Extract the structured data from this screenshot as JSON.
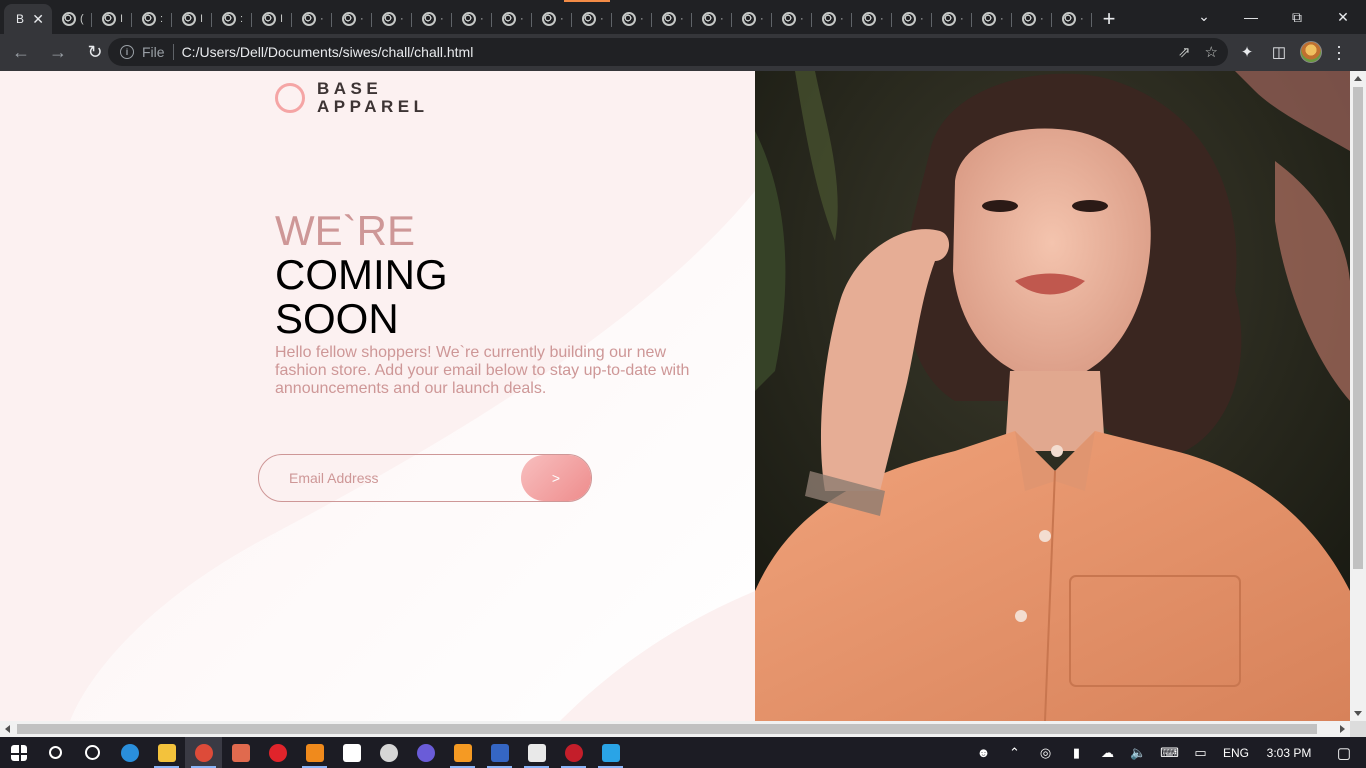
{
  "browser": {
    "active_tab": {
      "title": "B",
      "close": "✕"
    },
    "tabs": [
      {
        "title": "("
      },
      {
        "title": "I"
      },
      {
        "title": ":"
      },
      {
        "title": "I"
      },
      {
        "title": ":"
      },
      {
        "title": "I"
      },
      {
        "title": "·"
      },
      {
        "title": "·"
      },
      {
        "title": "·"
      },
      {
        "title": "·"
      },
      {
        "title": "·"
      },
      {
        "title": "·"
      },
      {
        "title": "·"
      },
      {
        "title": "·"
      },
      {
        "title": "·"
      },
      {
        "title": "·"
      },
      {
        "title": "·"
      },
      {
        "title": "·"
      },
      {
        "title": "·"
      },
      {
        "title": "·"
      },
      {
        "title": "·"
      },
      {
        "title": "·"
      },
      {
        "title": "·"
      },
      {
        "title": "·"
      },
      {
        "title": "·"
      },
      {
        "title": "·"
      }
    ],
    "new_tab_label": "+",
    "url_scheme": "File",
    "url": "C:/Users/Dell/Documents/siwes/chall/chall.html"
  },
  "page": {
    "logo": {
      "line1": "BASE",
      "line2": "APPAREL"
    },
    "headline": {
      "line1": "WE`RE",
      "line2": "COMING",
      "line3": "SOON"
    },
    "intro": "Hello fellow shoppers! We`re currently building our new fashion store. Add your email below to stay up-to-date with announcements and our launch deals.",
    "email_placeholder": "Email Address",
    "submit_label": ">",
    "colors": {
      "accent": "#ce9797",
      "ring": "#f5a5a5",
      "button_start": "#f8bfbf",
      "button_end": "#ee8c8c"
    },
    "hero_image": "woman-in-orange-shirt-photo"
  },
  "taskbar": {
    "apps": [
      "windows-start",
      "search",
      "cortana",
      "edge",
      "file-explorer",
      "chrome",
      "paint",
      "opera",
      "vlc",
      "people",
      "media",
      "firefox",
      "sublime",
      "word",
      "photos",
      "recorder",
      "intellij"
    ],
    "language": "ENG",
    "time": "3:03 PM"
  }
}
